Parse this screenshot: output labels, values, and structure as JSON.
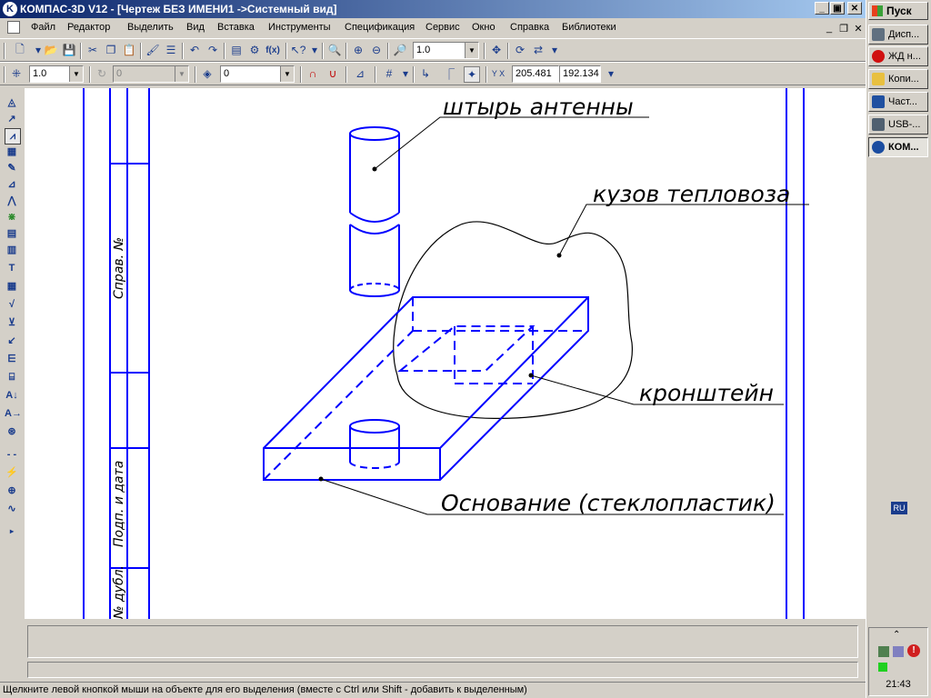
{
  "window": {
    "title": "КОМПАС-3D V12 - [Чертеж БЕЗ ИМЕНИ1 ->Системный вид]",
    "minimize": "_",
    "maximize": "▣",
    "close": "✕",
    "mdi_minimize": "_",
    "mdi_restore": "❐",
    "mdi_close": "✕"
  },
  "menu": {
    "items": [
      "Файл",
      "Редактор",
      "Выделить",
      "Вид",
      "Вставка",
      "Инструменты",
      "Спецификация",
      "Сервис",
      "Окно",
      "Справка",
      "Библиотеки"
    ]
  },
  "toolbar1": {
    "zoom_value": "1.0",
    "icons": [
      "new-document-icon",
      "open-icon",
      "save-icon",
      "cut-icon",
      "copy-icon",
      "paste-icon",
      "brush-icon",
      "properties-icon",
      "undo-icon",
      "redo-icon",
      "manager-icon",
      "variables-icon",
      "fx-icon",
      "help-cursor-icon",
      "zoom-window-icon",
      "zoom-in-icon",
      "zoom-out-icon",
      "zoom-scale-icon",
      "pan-icon",
      "refresh-icon",
      "rebuild-icon"
    ]
  },
  "toolbar2": {
    "step_value": "1.0",
    "angle_value": "0",
    "layer_value": "0",
    "x_coordinate": "205.481",
    "y_coordinate": "192.134",
    "xy_label": "Y X"
  },
  "drawing": {
    "stamp_labels": [
      "Справ. №",
      "Подп. и дата",
      "№ дубл."
    ],
    "callouts": [
      "штырь антенны",
      "кузов тепловоза",
      "кронштейн",
      "Основание (стеклопластик)"
    ],
    "line_color": "#0000ff"
  },
  "status": {
    "text": "Щелкните левой кнопкой мыши на объекте для его выделения (вместе с Ctrl или Shift - добавить к выделенным)"
  },
  "taskbar": {
    "start_label": "Пуск",
    "tasks": [
      {
        "label": "Дисп...",
        "icon": "device-manager-icon",
        "color": "#607080",
        "active": false
      },
      {
        "label": "ЖД н...",
        "icon": "opera-icon",
        "color": "#d01010",
        "active": false
      },
      {
        "label": "Копи...",
        "icon": "folder-icon",
        "color": "#e8c040",
        "active": false
      },
      {
        "label": "Част...",
        "icon": "word-icon",
        "color": "#2050a0",
        "active": false
      },
      {
        "label": "USB-...",
        "icon": "usb-icon",
        "color": "#506070",
        "active": false
      },
      {
        "label": "КОМ...",
        "icon": "kompas-icon",
        "color": "#1a4ca0",
        "active": true
      }
    ],
    "language": "RU",
    "tray_expand": "⌃",
    "clock": "21:43"
  }
}
